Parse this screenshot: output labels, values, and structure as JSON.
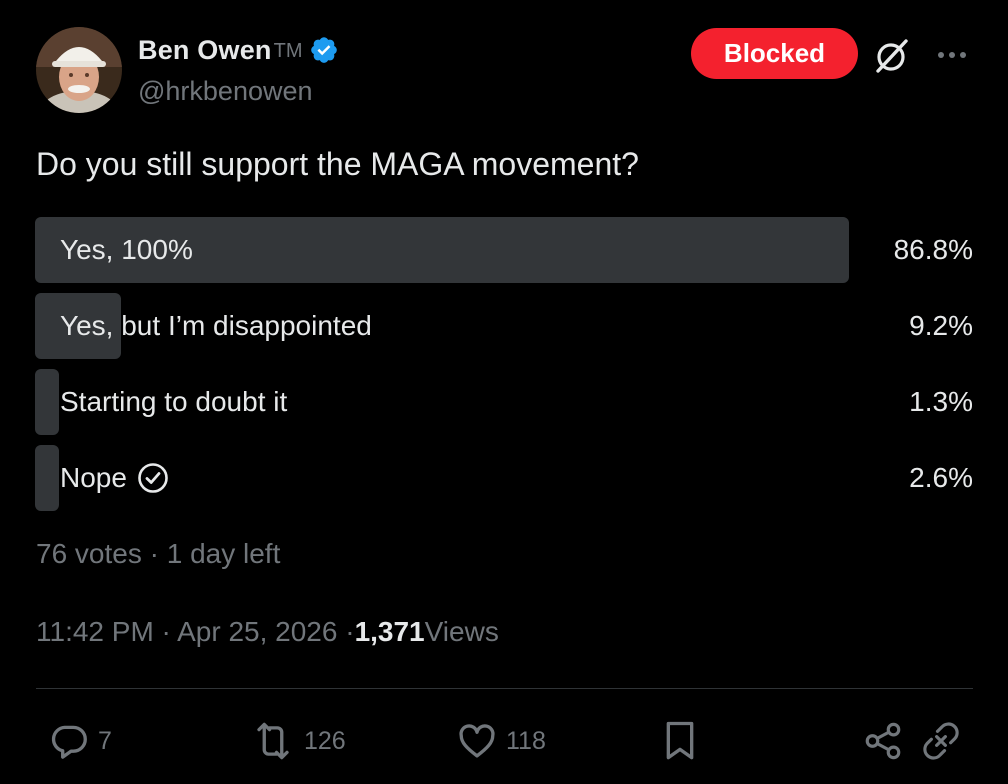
{
  "author": {
    "display_name": "Ben Owen",
    "tm": "TM",
    "handle": "@hrkbenowen",
    "verified": true
  },
  "header": {
    "blocked_label": "Blocked",
    "grok_icon": "grok-icon",
    "more_icon": "more-icon"
  },
  "tweet": {
    "question": "Do you still support the MAGA movement?"
  },
  "poll": {
    "options": [
      {
        "label": "Yes, 100%",
        "percent": "86.8%",
        "value": 86.8
      },
      {
        "label": "Yes, but I’m disappointed",
        "percent": "9.2%",
        "value": 9.2
      },
      {
        "label": "Starting to doubt it",
        "percent": "1.3%",
        "value": 1.3
      },
      {
        "label": "Nope",
        "percent": "2.6%",
        "value": 2.6,
        "selected": true
      }
    ],
    "meta": "76 votes · 1 day left"
  },
  "timestamp": {
    "time_date": "11:42 PM · Apr 25, 2026 · ",
    "views_count": "1,371",
    "views_label": " Views"
  },
  "actions": {
    "reply_count": "7",
    "retweet_count": "126",
    "like_count": "118"
  },
  "colors": {
    "background": "#000000",
    "primary_text": "#e7e9ea",
    "secondary_text": "#71767b",
    "blocked": "#f4212e",
    "verified": "#1d9bf0",
    "poll_bar": "#333639"
  }
}
